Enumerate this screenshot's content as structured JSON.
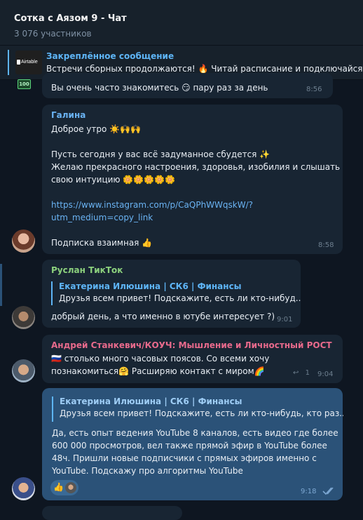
{
  "header": {
    "title": "Сотка с Аязом 9 - Чат",
    "subtitle": "3 076 участников"
  },
  "pinned": {
    "title": "Закреплённое сообщение",
    "text": "Встречи сборных продолжаются! 🔥 Читай расписание и подключайся",
    "thumb_label": "Airtable"
  },
  "messages": [
    {
      "id": "m0",
      "badge": "100",
      "text": "Вы очень часто знакомитесь 😏 пару раз за день",
      "time": "8:56"
    },
    {
      "id": "m1",
      "author": "Галина",
      "author_color": "#6ab3f3",
      "lines": [
        "Доброе утро ☀️🙌🙌",
        "",
        "Пусть сегодня у вас всё задуманное сбудется ✨",
        "Желаю прекрасного настроения, здоровья, изобилия и слышать",
        "свою интуицию 🌼🌼🌼🌼🌼"
      ],
      "link_lines": [
        "https://www.instagram.com/p/CaQPhWWqskW/?",
        "utm_medium=copy_link"
      ],
      "footer": "Подписка взаимная 👍",
      "time": "8:58"
    },
    {
      "id": "m2",
      "author": "Руслан ТикТок",
      "author_color": "#8cd17d",
      "reply_author": "Екатерина Илюшина | СК6 | Финансы",
      "reply_text": "Друзья всем привет! Подскажите, есть ли кто-нибуд...",
      "text": "добрый день, а что именно в ютубе интересует ?)",
      "time": "9:01"
    },
    {
      "id": "m3",
      "author": "Андрей Станкевич/КОУЧ: Мышление и Личностный РОСТ",
      "author_color": "#e86a8c",
      "lines": [
        "🇷🇺 столько много часовых поясов. Со всеми хочу",
        "познакомиться🤗 Расширяю контакт с миром🌈"
      ],
      "replies_count": "1",
      "time": "9:04"
    },
    {
      "id": "m4",
      "reply_author": "Екатерина Илюшина | СК6 | Финансы",
      "reply_text": "Друзья всем привет! Подскажите, есть ли кто-нибудь, кто раз...",
      "lines": [
        "Да, есть опыт ведения YouTube 8 каналов, есть видео где более",
        "600 000 просмотров, вел также прямой эфир в YouTube более",
        "48ч. Пришли новые подписчики с прямых эфиров именно с",
        "YouTube. Подскажу про алгоритмы YouTube"
      ],
      "reactions": "👍",
      "time": "9:18",
      "status_icon": "double-check-icon"
    }
  ]
}
